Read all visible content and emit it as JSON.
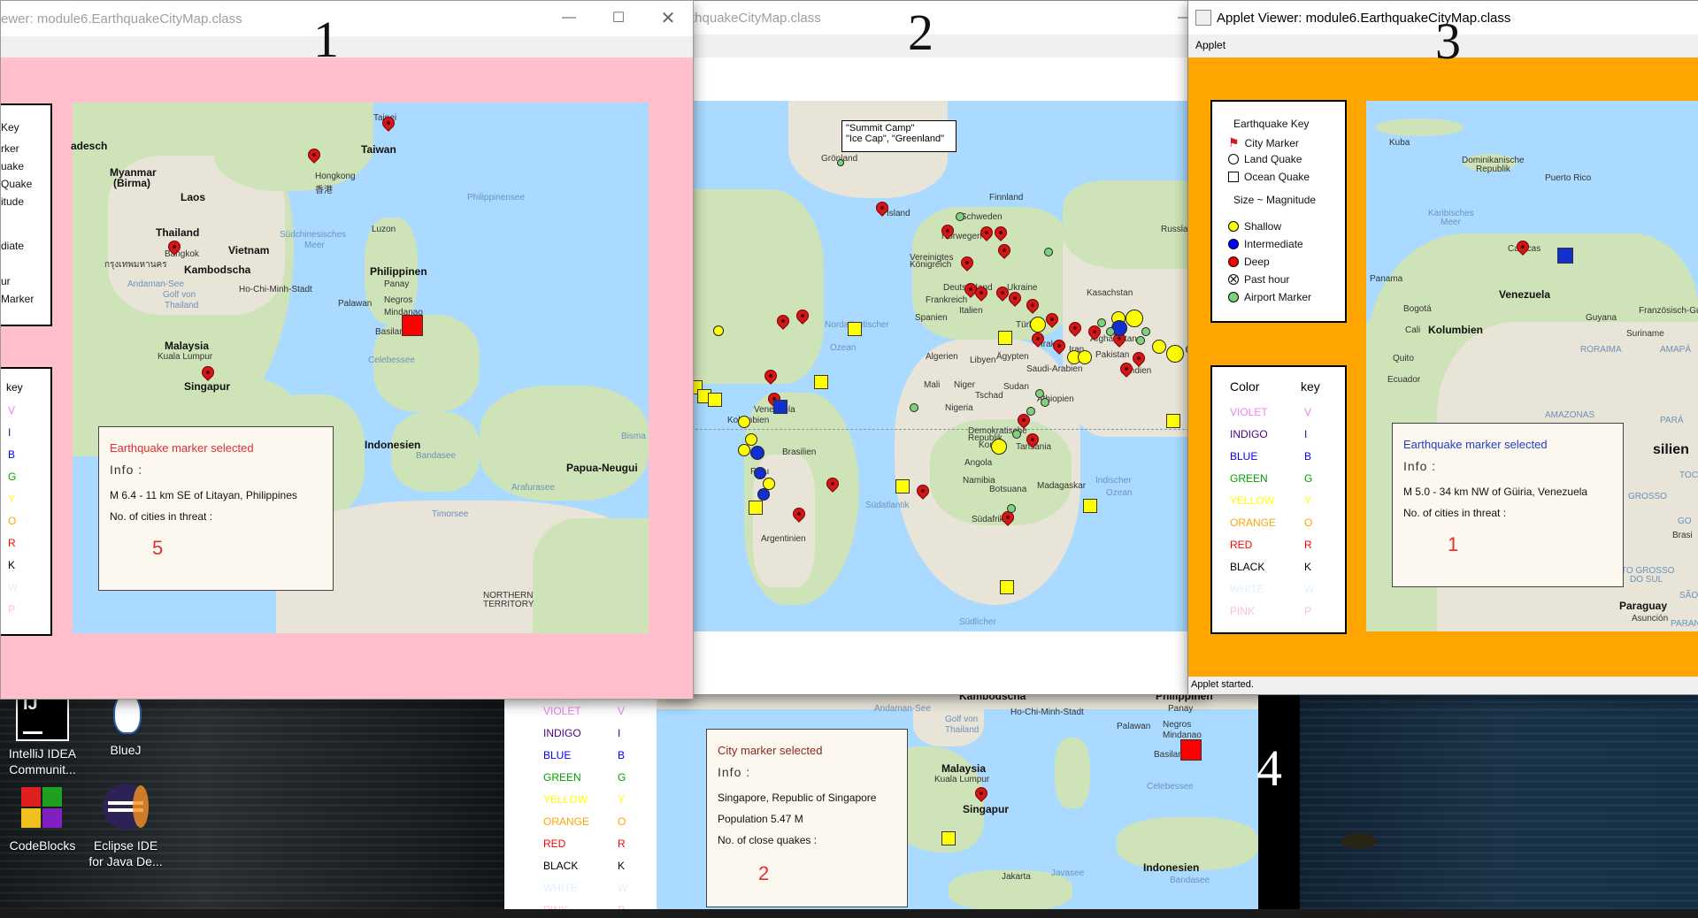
{
  "labels": {
    "one": "1",
    "two": "2",
    "three": "3",
    "four": "4"
  },
  "desktop": {
    "icons": [
      {
        "name": "IntelliJ IDEA Communit...",
        "line1": "IntelliJ IDEA",
        "line2": "Communit..."
      },
      {
        "name": "BlueJ",
        "line1": "BlueJ",
        "line2": ""
      },
      {
        "name": "CodeBlocks",
        "line1": "CodeBlocks",
        "line2": ""
      },
      {
        "name": "Eclipse IDE for Java De...",
        "line1": "Eclipse IDE",
        "line2": "for Java De..."
      }
    ]
  },
  "window1": {
    "title": "ewer: module6.EarthquakeCityMap.class",
    "bg": "#ffc0cb",
    "key": {
      "title": "Key",
      "lines": [
        "rker",
        "uake",
        "Quake",
        "itude",
        "",
        "diate",
        "",
        "ur",
        "Marker"
      ]
    },
    "colorkey": {
      "title": "key",
      "letters": [
        "V",
        "I",
        "B",
        "G",
        "Y",
        "O",
        "R",
        "K",
        "W",
        "P"
      ]
    },
    "map_labels": [
      "Taipei",
      "Taiwan",
      "adesch",
      "Myanmar",
      "(Birma)",
      "Laos",
      "Hongkong",
      "香港",
      "Philippinensee",
      "Thailand",
      "Bangkok",
      "กรุงเทพมหานคร",
      "Vietnam",
      "Südchinesisches",
      "Meer",
      "Luzon",
      "Kambodscha",
      "Andaman-See",
      "Golf von",
      "Thailand",
      "Ho-Chi-Minh-Stadt",
      "Philippinen",
      "Panay",
      "Palawan",
      "Negros",
      "Mindanao",
      "Basilan",
      "Malaysia",
      "Kuala Lumpur",
      "Singapur",
      "Celebessee",
      "Indonesien",
      "Bandasee",
      "Bisma",
      "Papua-Neugui",
      "Arafurasee",
      "Timorsee",
      "NORTHERN",
      "TERRITORY"
    ],
    "info": {
      "title": "Earthquake marker selected",
      "info": "Info :",
      "line1": "M 6.4 - 11 km SE of Litayan, Philippines",
      "line2": "No. of cities in threat :",
      "count": "5"
    }
  },
  "window2": {
    "title": "thquakeCityMap.class",
    "tooltip": {
      "line1": "\"Summit Camp\"",
      "line2": "\"Ice Cap\", \"Greenland\""
    },
    "map_labels": [
      "Grönland",
      "Island",
      "Finnland",
      "Schweden",
      "Norwegen",
      "Russland",
      "Vereinigtes",
      "Königreich",
      "Deutschland",
      "Ukraine",
      "Frankreich",
      "Italien",
      "Spanien",
      "Kasachstan",
      "Türkei",
      "Irak",
      "Iran",
      "Afghanistan",
      "Pakistan",
      "Indien",
      "Saudi-Arabien",
      "Ägypten",
      "Libyen",
      "Algerien",
      "Mali",
      "Niger",
      "Tschad",
      "Sudan",
      "Äthiopien",
      "Nigeria",
      "Demokratische",
      "Republik",
      "Kongo",
      "Tansania",
      "Angola",
      "Namibia",
      "Botsuana",
      "Madagaskar",
      "Südafrika",
      "Nordatlantischer",
      "Ozean",
      "Venezuela",
      "Kolumbien",
      "Brasilien",
      "Peru",
      "Argentinien",
      "Südatlantik",
      "Indischer",
      "Ozean",
      "Südlicher"
    ]
  },
  "window3": {
    "title": "Applet Viewer: module6.EarthquakeCityMap.class",
    "menu": "Applet",
    "status": "Applet started.",
    "bg": "#ffa500",
    "key": {
      "title": "Earthquake Key",
      "city": "City Marker",
      "land": "Land Quake",
      "ocean": "Ocean Quake",
      "size": "Size ~ Magnitude",
      "shallow": "Shallow",
      "intermediate": "Intermediate",
      "deep": "Deep",
      "pasthour": "Past hour",
      "airport": "Airport Marker"
    },
    "colorkey": {
      "header_color": "Color",
      "header_key": "key",
      "rows": [
        {
          "name": "VIOLET",
          "key": "V",
          "color": "#ee82ee"
        },
        {
          "name": "INDIGO",
          "key": "I",
          "color": "#4b0082"
        },
        {
          "name": "BLUE",
          "key": "B",
          "color": "#0000ff"
        },
        {
          "name": "GREEN",
          "key": "G",
          "color": "#00a000"
        },
        {
          "name": "YELLOW",
          "key": "Y",
          "color": "#ffff00"
        },
        {
          "name": "ORANGE",
          "key": "O",
          "color": "#ffa500"
        },
        {
          "name": "RED",
          "key": "R",
          "color": "#ff0000"
        },
        {
          "name": "BLACK",
          "key": "K",
          "color": "#000000"
        },
        {
          "name": "WHITE",
          "key": "W",
          "color": "#e0f0ff"
        },
        {
          "name": "PINK",
          "key": "P",
          "color": "#ffc0cb"
        }
      ]
    },
    "map_labels": [
      "Kuba",
      "Dominikanische",
      "Republik",
      "Puerto Rico",
      "Karibisches",
      "Meer",
      "Panama",
      "Caracas",
      "Venezuela",
      "Bogotá",
      "Cali",
      "Kolumbien",
      "Guyana",
      "Französisch-Guy",
      "Suriname",
      "RORAIMA",
      "AMAPÁ",
      "Quito",
      "Ecuador",
      "AMAZONAS",
      "PARÁ",
      "silien",
      "TOC",
      "GROSSO",
      "GO",
      "Brasi",
      "TO GROSSO",
      "DO SUL",
      "SÃO",
      "Paraguay",
      "Asunción",
      "PARANÁ"
    ],
    "info": {
      "title": "Earthquake marker selected",
      "info": "Info :",
      "line1": "M 5.0 - 34 km NW of Güiria, Venezuela",
      "line2": "No. of cities in threat :",
      "count": "1"
    }
  },
  "window4": {
    "colorkey": [
      "VIOLET",
      "INDIGO",
      "BLUE",
      "GREEN",
      "YELLOW",
      "ORANGE",
      "RED",
      "BLACK",
      "WHITE",
      "PINK"
    ],
    "keys": [
      "V",
      "I",
      "B",
      "G",
      "Y",
      "O",
      "R",
      "K",
      "W",
      "P"
    ],
    "map_labels": [
      "Kambodscha",
      "Philippinen",
      "Panay",
      "Andaman-See",
      "Golf von",
      "Thailand",
      "Ho-Chi-Minh-Stadt",
      "Palawan",
      "Negros",
      "Mindanao",
      "Basilan",
      "Malaysia",
      "Kuala Lumpur",
      "Singapur",
      "Celebessee",
      "Jakarta",
      "Javasee",
      "Indonesien",
      "Bandasee"
    ],
    "info": {
      "title": "City marker selected",
      "info": "Info :",
      "line1": "Singapore, Republic of Singapore",
      "line2": "Population  5.47 M",
      "line3": "No. of close quakes :",
      "count": "2"
    }
  }
}
